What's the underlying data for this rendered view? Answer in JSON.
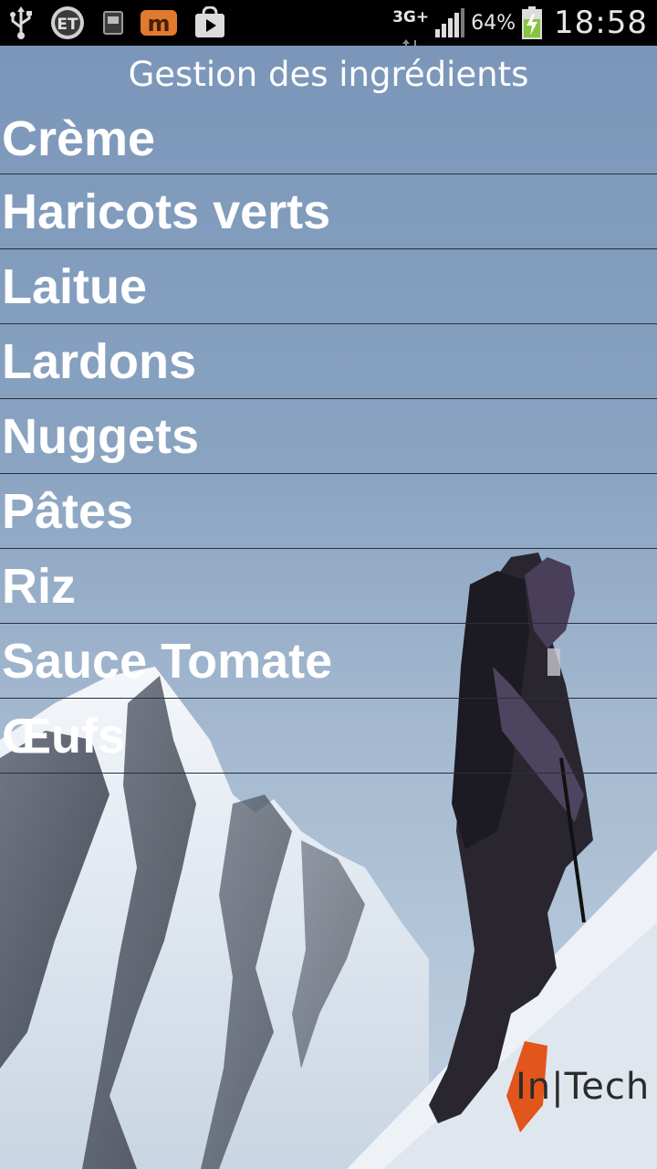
{
  "status_bar": {
    "notification_icons": [
      "usb-icon",
      "et-app-icon",
      "screenshot-icon",
      "m-app-icon",
      "play-store-icon"
    ],
    "network_type": "3G+",
    "battery_percent": "64%",
    "time": "18:58"
  },
  "app": {
    "title": "Gestion des ingrédients",
    "items": [
      {
        "label": "Crème"
      },
      {
        "label": "Haricots verts"
      },
      {
        "label": "Laitue"
      },
      {
        "label": "Lardons"
      },
      {
        "label": "Nuggets"
      },
      {
        "label": "Pâtes"
      },
      {
        "label": "Riz"
      },
      {
        "label": "Sauce Tomate"
      },
      {
        "label": "Œufs"
      }
    ],
    "brand": {
      "logo_text": "In|Tech",
      "accent_color": "#e2551b"
    }
  }
}
